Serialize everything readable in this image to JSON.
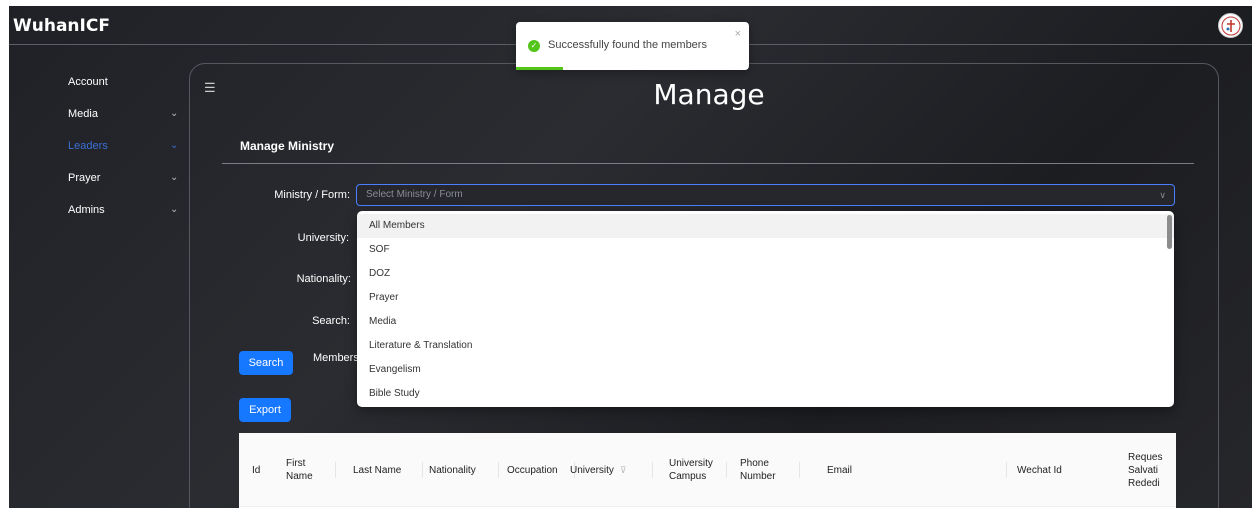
{
  "brand": "WuhanICF",
  "toast": {
    "message": "Successfully found the members",
    "close": "×",
    "progress": 0.2
  },
  "sidebar": {
    "items": [
      {
        "label": "Account",
        "chevron": ""
      },
      {
        "label": "Media",
        "chevron": "⌄"
      },
      {
        "label": "Leaders",
        "chevron": "⌄",
        "active": true
      },
      {
        "label": "Prayer",
        "chevron": "⌄"
      },
      {
        "label": "Admins",
        "chevron": "⌄"
      }
    ]
  },
  "header": {
    "menu_icon": "☰",
    "title": "Manage"
  },
  "section": {
    "title": "Manage Ministry"
  },
  "form": {
    "ministry_label": "Ministry / Form:",
    "ministry_placeholder": "Select Ministry / Form",
    "university_label": "University:",
    "nationality_label": "Nationality:",
    "search_label": "Search:",
    "members_label": "Members"
  },
  "buttons": {
    "search": "Search",
    "export": "Export"
  },
  "dropdown": {
    "options": [
      "All Members",
      "SOF",
      "DOZ",
      "Prayer",
      "Media",
      "Literature & Translation",
      "Evangelism",
      "Bible Study"
    ]
  },
  "table": {
    "columns": [
      "Id",
      "First Name",
      "Last Name",
      "Nationality",
      "Occupation",
      "University",
      "University Campus",
      "Phone Number",
      "Email",
      "Wechat Id",
      "Reques Salvati Rededi"
    ]
  },
  "colors": {
    "accent": "#1677ff",
    "active_nav": "#3b6fd4",
    "success": "#52c41a"
  }
}
